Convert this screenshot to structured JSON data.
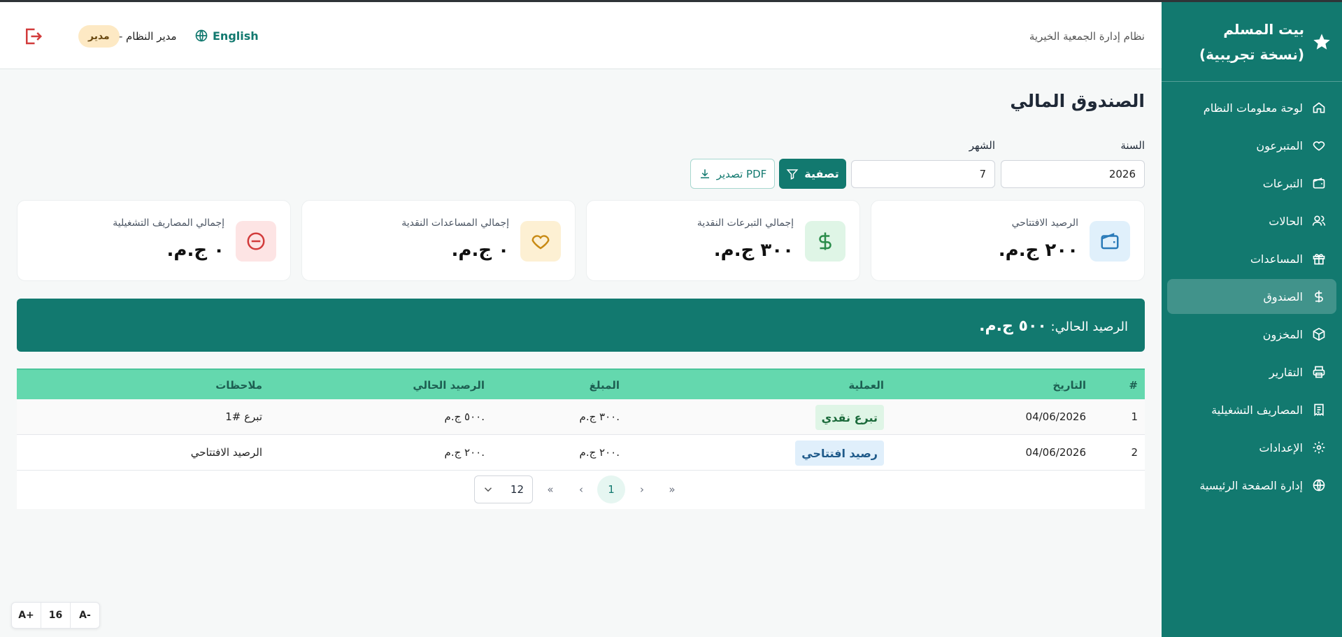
{
  "brand": {
    "name": "بيت المسلم (نسخة تجريبية)"
  },
  "sidebar": {
    "items": [
      {
        "label": "لوحة معلومات النظام",
        "icon": "home-icon"
      },
      {
        "label": "المتبرعون",
        "icon": "heart-icon"
      },
      {
        "label": "التبرعات",
        "icon": "wallet-icon"
      },
      {
        "label": "الحالات",
        "icon": "users-icon"
      },
      {
        "label": "المساعدات",
        "icon": "gift-icon"
      },
      {
        "label": "الصندوق",
        "icon": "dollar-icon",
        "active": true
      },
      {
        "label": "المخزون",
        "icon": "box-icon"
      },
      {
        "label": "التقارير",
        "icon": "printer-icon"
      },
      {
        "label": "المصاريف التشغيلية",
        "icon": "receipt-icon"
      },
      {
        "label": "الإعدادات",
        "icon": "gear-icon"
      },
      {
        "label": "إدارة الصفحة الرئيسية",
        "icon": "globe-icon"
      }
    ]
  },
  "header": {
    "system_title": "نظام إدارة الجمعية الخيرية",
    "language": "English",
    "user_name": "مدير النظام",
    "separator": "-",
    "user_role": "مدير"
  },
  "page": {
    "title": "الصندوق المالي",
    "filters": {
      "year_label": "السنة",
      "year_value": "2026",
      "month_label": "الشهر",
      "month_value": "7",
      "filter_button": "تصفية",
      "export_button": "تصدير PDF"
    }
  },
  "cards": [
    {
      "title": "الرصيد الافتتاحي",
      "value": "٢٠٠ ج.م.",
      "icon": "wallet-icon",
      "color": "#e0f0fb",
      "icon_color": "#2b7bb9"
    },
    {
      "title": "إجمالي التبرعات النقدية",
      "value": "٣٠٠ ج.م.",
      "icon": "dollar-icon",
      "color": "#dff5e6",
      "icon_color": "#2a8c4a"
    },
    {
      "title": "إجمالي المساعدات النقدية",
      "value": "٠ ج.م.",
      "icon": "heart-icon",
      "color": "#fdf0d3",
      "icon_color": "#c88a14"
    },
    {
      "title": "إجمالي المصاريف التشغيلية",
      "value": "٠ ج.م.",
      "icon": "minus-circle-icon",
      "color": "#fde4e4",
      "icon_color": "#d23b3b"
    }
  ],
  "balance": {
    "label": "الرصيد الحالي:",
    "value": "٥٠٠ ج.م."
  },
  "table": {
    "headers": {
      "index": "#",
      "date": "التاريخ",
      "operation": "العملية",
      "amount": "المبلغ",
      "balance": "الرصيد الحالي",
      "notes": "ملاحظات"
    },
    "rows": [
      {
        "index": "1",
        "date": "04/06/2026",
        "operation": "تبرع نقدي",
        "amount": "٣٠٠ ج.م.",
        "balance": "٥٠٠ ج.م.",
        "notes": "تبرع #1"
      },
      {
        "index": "2",
        "date": "04/06/2026",
        "operation": "رصيد افتتاحي",
        "amount": "٢٠٠ ج.م.",
        "balance": "٢٠٠ ج.م.",
        "notes": "الرصيد الافتتاحي"
      }
    ]
  },
  "pagination": {
    "page_size": "12",
    "current_page": "1",
    "first": "«",
    "prev": "‹",
    "next": "›",
    "last": "»"
  },
  "font_control": {
    "increase": "A+",
    "size": "16",
    "decrease": "A-"
  }
}
